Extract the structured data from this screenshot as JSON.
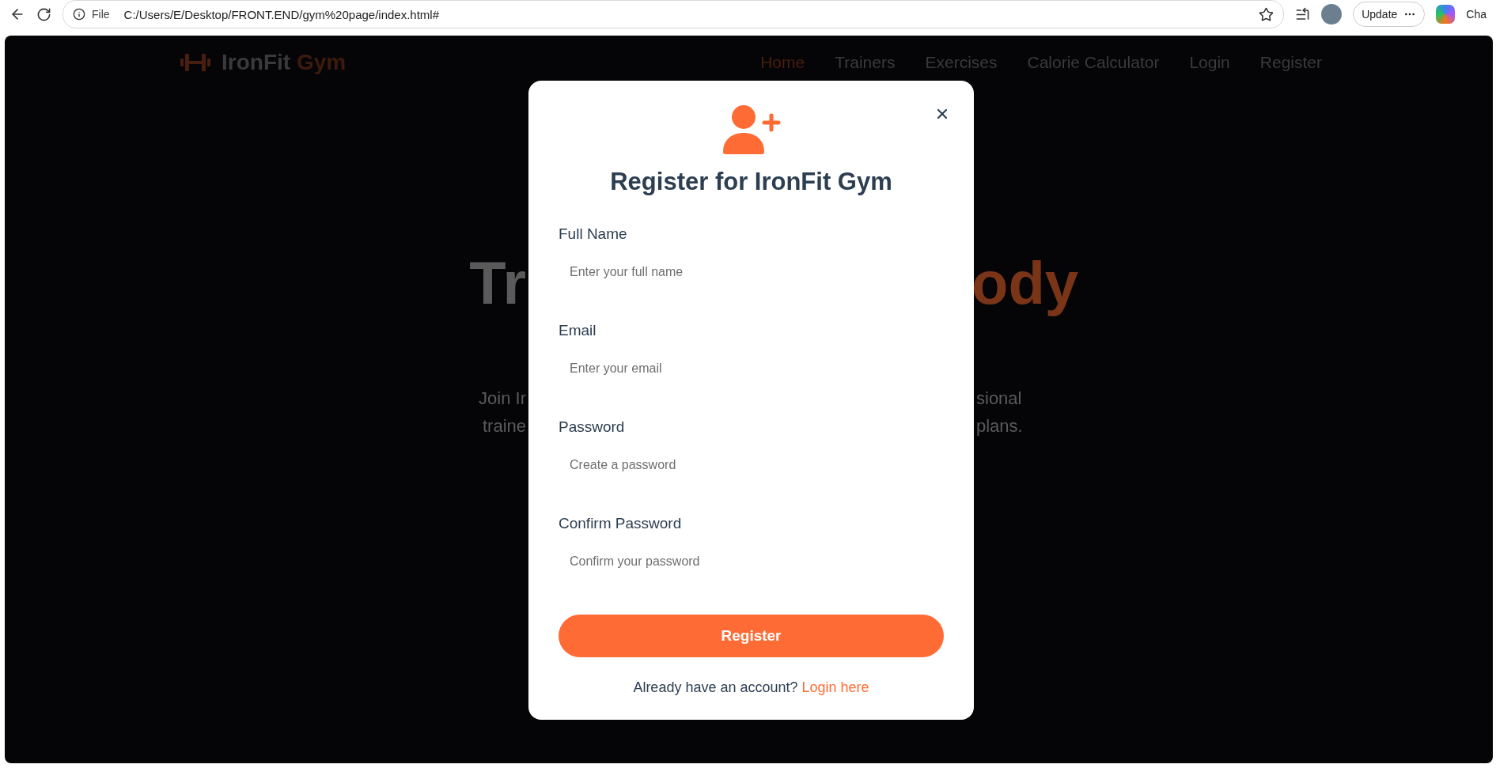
{
  "browser": {
    "scheme_label": "File",
    "url": "C:/Users/E/Desktop/FRONT.END/gym%20page/index.html#",
    "update_button": "Update",
    "side_panel_label": "Cha"
  },
  "nav": {
    "brand": {
      "name": "IronFit",
      "accent": "Gym"
    },
    "links": [
      {
        "label": "Home",
        "selected": true
      },
      {
        "label": "Trainers",
        "selected": false
      },
      {
        "label": "Exercises",
        "selected": false
      },
      {
        "label": "Calorie Calculator",
        "selected": false
      },
      {
        "label": "Login",
        "selected": false
      },
      {
        "label": "Register",
        "selected": false
      }
    ]
  },
  "hero": {
    "heading_left": "Tr",
    "heading_right": "ody",
    "paragraph_lines": [
      {
        "left": "Join Ir",
        "right": "sional"
      },
      {
        "left": "traine",
        "right": "plans."
      }
    ]
  },
  "modal": {
    "title": "Register for IronFit Gym",
    "fields": [
      {
        "label": "Full Name",
        "placeholder": "Enter your full name"
      },
      {
        "label": "Email",
        "placeholder": "Enter your email"
      },
      {
        "label": "Password",
        "placeholder": "Create a password"
      },
      {
        "label": "Confirm Password",
        "placeholder": "Confirm your password"
      }
    ],
    "submit": "Register",
    "footer": {
      "text": "Already have an account?",
      "link": "Login here"
    }
  }
}
